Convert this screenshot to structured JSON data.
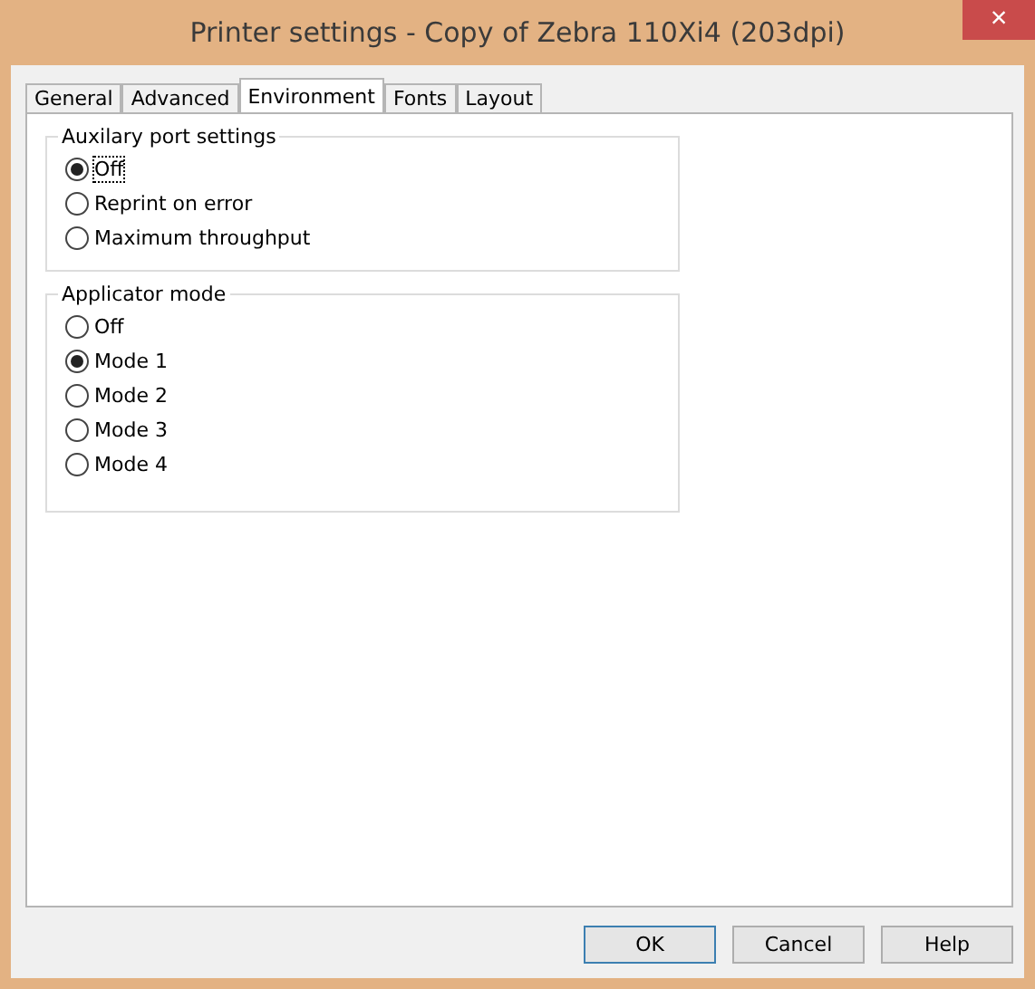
{
  "window": {
    "title": "Printer settings - Copy of Zebra 110Xi4 (203dpi)",
    "close": "×"
  },
  "tabs": [
    {
      "label": "General",
      "selected": false
    },
    {
      "label": "Advanced",
      "selected": false
    },
    {
      "label": "Environment",
      "selected": true
    },
    {
      "label": "Fonts",
      "selected": false
    },
    {
      "label": "Layout",
      "selected": false
    }
  ],
  "groups": [
    {
      "title": "Auxilary port settings",
      "options": [
        {
          "label": "Off",
          "selected": true,
          "focused": true
        },
        {
          "label": "Reprint on error",
          "selected": false,
          "focused": false
        },
        {
          "label": "Maximum throughput",
          "selected": false,
          "focused": false
        }
      ]
    },
    {
      "title": "Applicator mode",
      "options": [
        {
          "label": "Off",
          "selected": false,
          "focused": false
        },
        {
          "label": "Mode 1",
          "selected": true,
          "focused": false
        },
        {
          "label": "Mode 2",
          "selected": false,
          "focused": false
        },
        {
          "label": "Mode 3",
          "selected": false,
          "focused": false
        },
        {
          "label": "Mode 4",
          "selected": false,
          "focused": false
        }
      ]
    }
  ],
  "buttons": [
    {
      "label": "OK",
      "default": true
    },
    {
      "label": "Cancel",
      "default": false
    },
    {
      "label": "Help",
      "default": false
    }
  ]
}
